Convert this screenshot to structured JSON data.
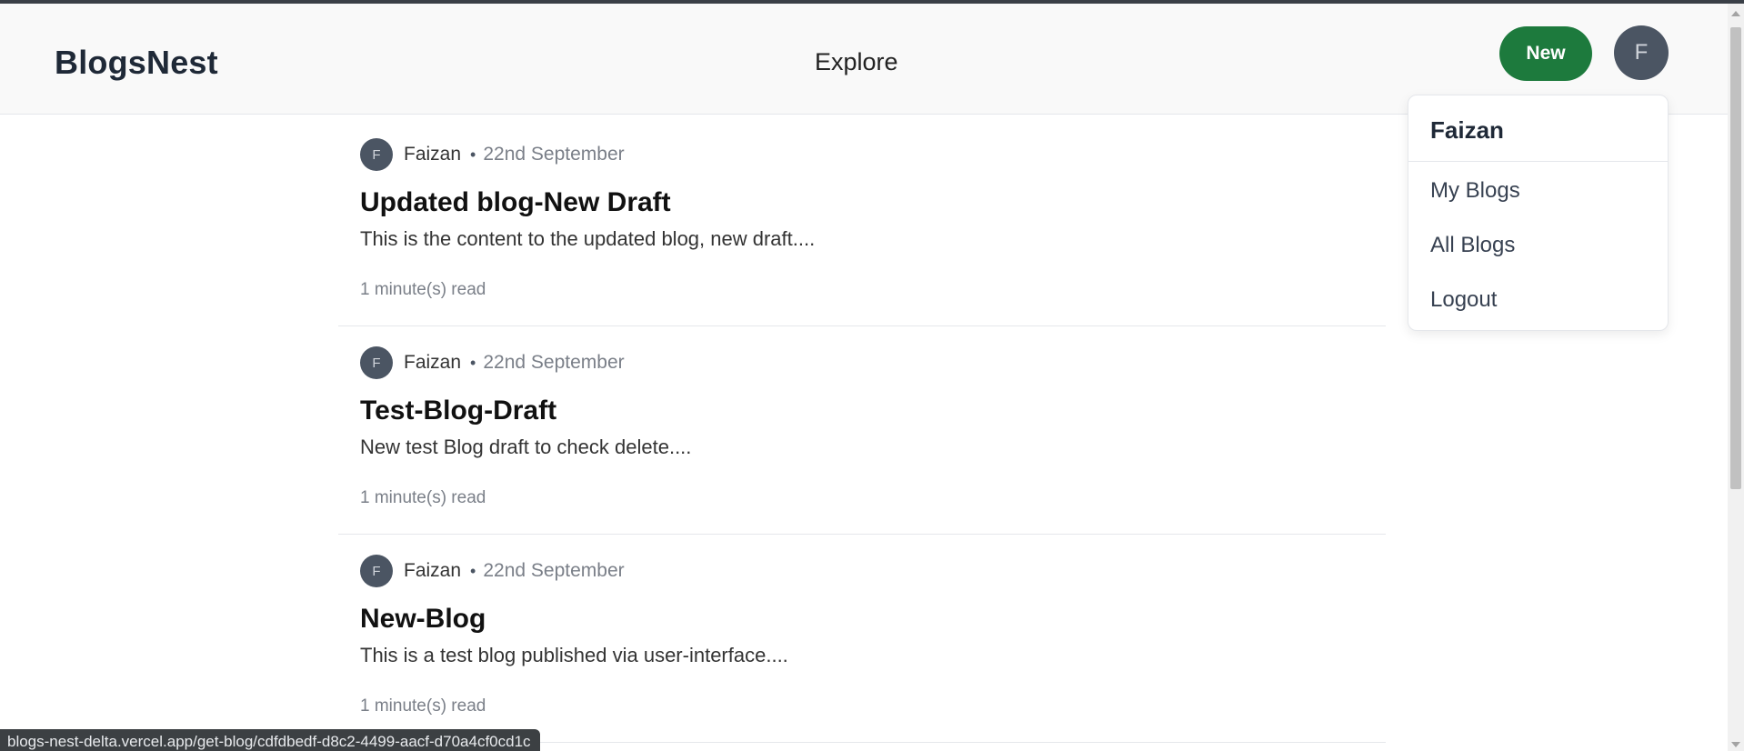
{
  "header": {
    "brand": "BlogsNest",
    "nav_explore": "Explore",
    "new_label": "New",
    "avatar_initial": "F"
  },
  "dropdown": {
    "user_name": "Faizan",
    "items": [
      {
        "label": "My Blogs"
      },
      {
        "label": "All Blogs"
      },
      {
        "label": "Logout"
      }
    ]
  },
  "posts": [
    {
      "avatar_initial": "F",
      "author": "Faizan",
      "separator": "•",
      "date": "22nd September",
      "title": "Updated blog-New Draft",
      "excerpt": "This is the content to the updated blog, new draft....",
      "read_time": "1 minute(s) read"
    },
    {
      "avatar_initial": "F",
      "author": "Faizan",
      "separator": "•",
      "date": "22nd September",
      "title": "Test-Blog-Draft",
      "excerpt": "New test Blog draft to check delete....",
      "read_time": "1 minute(s) read"
    },
    {
      "avatar_initial": "F",
      "author": "Faizan",
      "separator": "•",
      "date": "22nd September",
      "title": "New-Blog",
      "excerpt": "This is a test blog published via user-interface....",
      "read_time": "1 minute(s) read"
    }
  ],
  "status_bar": {
    "url": "blogs-nest-delta.vercel.app/get-blog/cdfdbedf-d8c2-4499-aacf-d70a4cf0cd1c"
  },
  "colors": {
    "accent_green": "#1d7a3d",
    "avatar_bg": "#4b5563",
    "header_bg": "#f9f9f9"
  }
}
